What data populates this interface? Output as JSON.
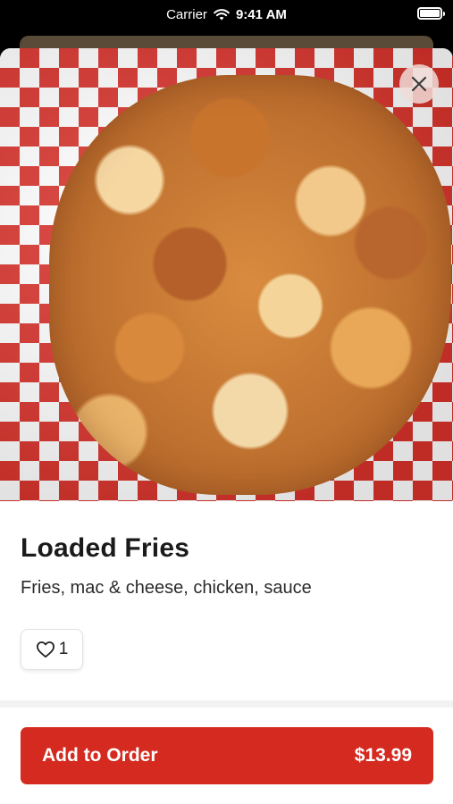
{
  "status_bar": {
    "carrier": "Carrier",
    "time": "9:41 AM"
  },
  "item": {
    "title": "Loaded Fries",
    "description": "Fries, mac & cheese, chicken, sauce",
    "likes": "1",
    "image_icon": "food-photo"
  },
  "actions": {
    "close_icon": "close-icon",
    "add_label": "Add to Order",
    "price": "$13.99"
  },
  "colors": {
    "accent": "#d52a1f",
    "checker": "#d9322b",
    "background": "#ffffff"
  }
}
